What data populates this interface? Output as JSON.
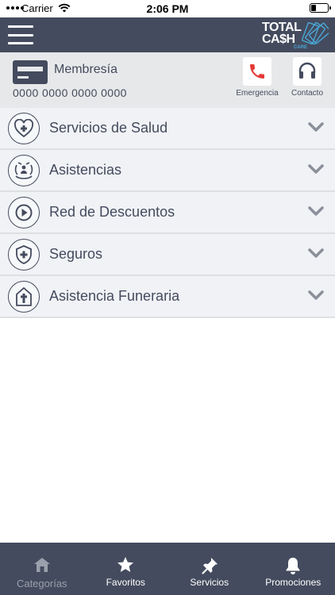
{
  "status_bar": {
    "carrier": "Carrier",
    "time": "2:06 PM"
  },
  "header": {
    "logo_line1": "TOTAL",
    "logo_line2": "CA$H",
    "logo_sub": "CARE",
    "menu_icon": "hamburger-icon"
  },
  "membership": {
    "title": "Membresía",
    "number": "0000 0000 0000 0000",
    "icon": "credit-card-icon",
    "actions": [
      {
        "label": "Emergencia",
        "icon": "phone-icon",
        "color": "#e53935"
      },
      {
        "label": "Contacto",
        "icon": "headset-icon",
        "color": "#444b5e"
      }
    ]
  },
  "categories": [
    {
      "label": "Servicios de Salud",
      "icon": "heart-plus-icon"
    },
    {
      "label": "Asistencias",
      "icon": "hands-person-icon"
    },
    {
      "label": "Red de Descuentos",
      "icon": "play-icon"
    },
    {
      "label": "Seguros",
      "icon": "shield-plus-icon"
    },
    {
      "label": "Asistencia Funeraria",
      "icon": "chapel-cross-icon"
    }
  ],
  "tabs": [
    {
      "label": "Categorías",
      "icon": "home-icon",
      "active": true
    },
    {
      "label": "Favoritos",
      "icon": "star-icon",
      "active": false
    },
    {
      "label": "Servicios",
      "icon": "pin-icon",
      "active": false
    },
    {
      "label": "Promociones",
      "icon": "bell-icon",
      "active": false
    }
  ],
  "colors": {
    "primary": "#444b5e",
    "membership_bg": "#e7e8ea",
    "list_bg": "#f1f2f6",
    "emergency": "#e53935",
    "inactive_tab": "#9aa0ac"
  }
}
